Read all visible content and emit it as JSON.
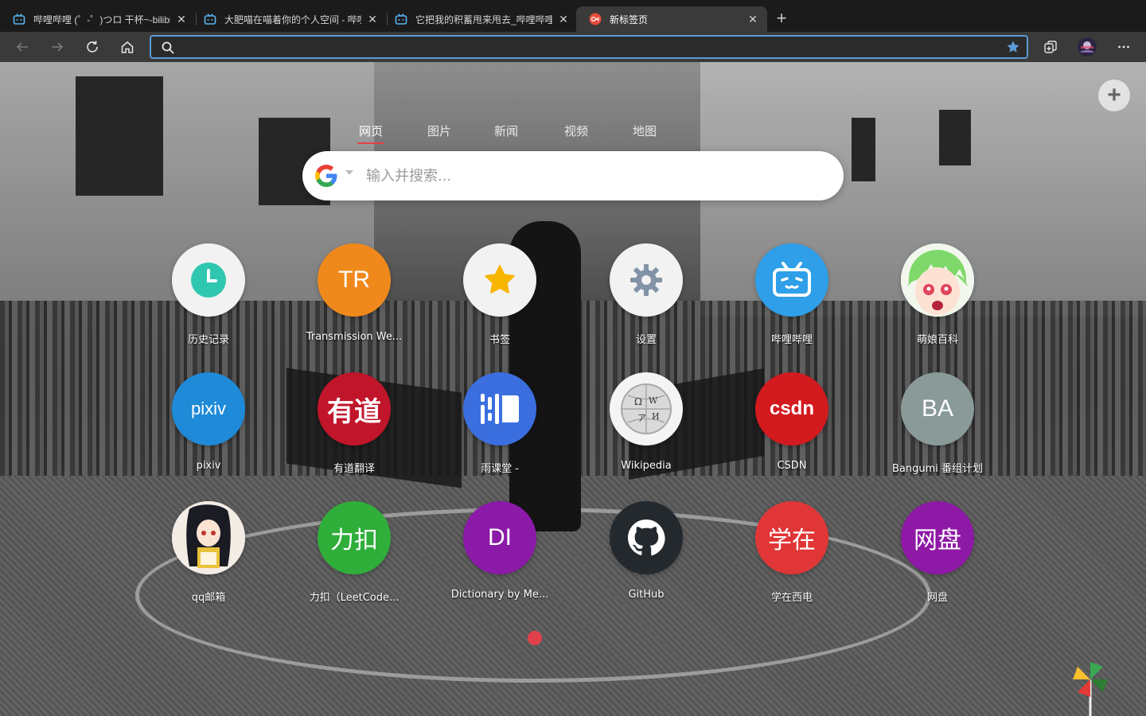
{
  "tabs": [
    {
      "title": "哔哩哔哩 (゜-゜)つロ 干杯~-bilibili",
      "icon": "bilibili-icon",
      "active": false
    },
    {
      "title": "大肥喵在喵着你的个人空间 - 哔哩哔哩",
      "icon": "bilibili-icon",
      "active": false
    },
    {
      "title": "它把我的积蓄甩来甩去_哔哩哔哩",
      "icon": "bilibili-icon",
      "active": false
    },
    {
      "title": "新标签页",
      "icon": "infinity-icon",
      "active": true
    }
  ],
  "toolbar": {
    "address_value": "",
    "address_placeholder": ""
  },
  "search": {
    "tabs": [
      "网页",
      "图片",
      "新闻",
      "视频",
      "地图"
    ],
    "placeholder": "输入并搜索..."
  },
  "tiles": [
    {
      "label": "历史记录",
      "icon": "clock-icon",
      "text": "",
      "bg": "#f2f2f2"
    },
    {
      "label": "Transmission We...",
      "icon": "",
      "text": "TR",
      "bg": "#f0891c"
    },
    {
      "label": "书签",
      "icon": "star-icon",
      "text": "",
      "bg": "#f2f2f2"
    },
    {
      "label": "设置",
      "icon": "gear-icon",
      "text": "",
      "bg": "#f2f2f2"
    },
    {
      "label": "哔哩哔哩",
      "icon": "bilibili-tv-icon",
      "text": "",
      "bg": "#2e9fe8"
    },
    {
      "label": "萌娘百科",
      "icon": "moegirl-avatar-icon",
      "text": "",
      "bg": "#e9f3e6"
    },
    {
      "label": "pixiv",
      "icon": "",
      "text": "pixiv",
      "bg": "#1e8ad8"
    },
    {
      "label": "有道翻译",
      "icon": "",
      "text": "有道",
      "bg": "#c0152a"
    },
    {
      "label": "雨课堂 -",
      "icon": "yuketang-icon",
      "text": "",
      "bg": "#3b6fe0"
    },
    {
      "label": "Wikipedia",
      "icon": "wikipedia-globe-icon",
      "text": "",
      "bg": "#f4f4f4"
    },
    {
      "label": "CSDN",
      "icon": "",
      "text": "csdn",
      "bg": "#d21a1f"
    },
    {
      "label": "Bangumi 番组计划",
      "icon": "",
      "text": "BA",
      "bg": "#8a9a98"
    },
    {
      "label": "qq邮箱",
      "icon": "anime-avatar-icon",
      "text": "",
      "bg": "#efe8e2"
    },
    {
      "label": "力扣（LeetCode...",
      "icon": "",
      "text": "力扣",
      "bg": "#2fae3a"
    },
    {
      "label": "Dictionary by Me...",
      "icon": "",
      "text": "DI",
      "bg": "#8b1aa8"
    },
    {
      "label": "GitHub",
      "icon": "github-icon",
      "text": "",
      "bg": "#24292e"
    },
    {
      "label": "学在西电",
      "icon": "",
      "text": "学在",
      "bg": "#e13637"
    },
    {
      "label": "网盘",
      "icon": "",
      "text": "网盘",
      "bg": "#8e19a6"
    }
  ],
  "colors": {
    "accent": "#5b9bd8",
    "search_tab_underline": "#e0404a",
    "page_dot": "#e0404a"
  }
}
